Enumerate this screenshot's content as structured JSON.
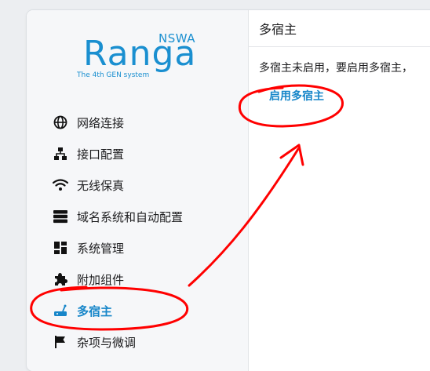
{
  "logo": {
    "name": "Ranga",
    "badge": "NSWA",
    "tagline": "The 4th GEN system",
    "color": "#1a8fd0"
  },
  "sidebar": {
    "items": [
      {
        "label": "网络连接",
        "icon": "globe-icon"
      },
      {
        "label": "接口配置",
        "icon": "network-tree-icon"
      },
      {
        "label": "无线保真",
        "icon": "wifi-icon"
      },
      {
        "label": "域名系统和自动配置",
        "icon": "server-stack-icon"
      },
      {
        "label": "系统管理",
        "icon": "dashboard-icon"
      },
      {
        "label": "附加组件",
        "icon": "puzzle-icon"
      },
      {
        "label": "多宿主",
        "icon": "router-icon",
        "active": true
      },
      {
        "label": "杂项与微调",
        "icon": "flag-icon"
      }
    ]
  },
  "main": {
    "title": "多宿主",
    "message": "多宿主未启用，要启用多宿主，",
    "enable_label": "启用多宿主"
  },
  "colors": {
    "accent": "#1786c9",
    "annotation": "#ff0000"
  }
}
